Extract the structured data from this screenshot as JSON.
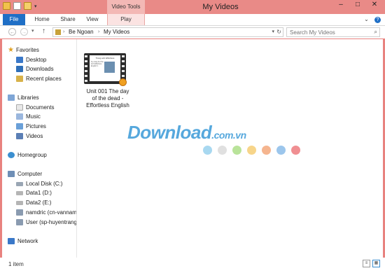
{
  "window": {
    "title": "My Videos",
    "context_tab_group": "Video Tools",
    "controls": {
      "minimize": "–",
      "maximize": "□",
      "close": "✕"
    }
  },
  "quick_access": {
    "dropdown_arrow": "▾"
  },
  "ribbon": {
    "tabs": [
      "File",
      "Home",
      "Share",
      "View",
      "Play"
    ],
    "collapse_arrow": "⌄",
    "help": "?"
  },
  "address_bar": {
    "back": "←",
    "forward": "→",
    "recent": "▾",
    "up": "↑",
    "crumbs": [
      "Be Ngoan",
      "My Videos"
    ],
    "separator": "›",
    "dropdown": "▾",
    "refresh": "↻"
  },
  "search": {
    "placeholder": "Search My Videos",
    "icon": "⌕"
  },
  "navigation": {
    "favorites": {
      "label": "Favorites",
      "items": [
        "Desktop",
        "Downloads",
        "Recent places"
      ]
    },
    "libraries": {
      "label": "Libraries",
      "items": [
        "Documents",
        "Music",
        "Pictures",
        "Videos"
      ]
    },
    "homegroup": {
      "label": "Homegroup"
    },
    "computer": {
      "label": "Computer",
      "items": [
        "Local Disk (C:)",
        "Data1 (D:)",
        "Data2 (E:)",
        "namdric (cn-vannam",
        "User (sp-huyentrang"
      ]
    },
    "network": {
      "label": "Network"
    }
  },
  "files": [
    {
      "name_lines": [
        "Unit 001 The day",
        "of the dead -",
        "Effortless English"
      ],
      "thumbnail": {
        "slide_title": "Trang anh Effortless",
        "slide_body": "Ky nang An Khe Anh Effortless English 1"
      }
    }
  ],
  "watermark": {
    "text": "Download",
    "suffix": ".com.vn",
    "dot_colors": [
      "#a8d8f0",
      "#e0e0e0",
      "#b9e39a",
      "#f7d58a",
      "#f5b58f",
      "#9cc6ec",
      "#f08f92"
    ]
  },
  "status_bar": {
    "item_count": "1 item",
    "details_view": "≡",
    "icons_view": "▦"
  },
  "colors": {
    "titlebar": "#e98a87",
    "file_tab": "#1f6fc6",
    "context_tab": "#f3b8b5",
    "watermark": "#56a8dd"
  }
}
